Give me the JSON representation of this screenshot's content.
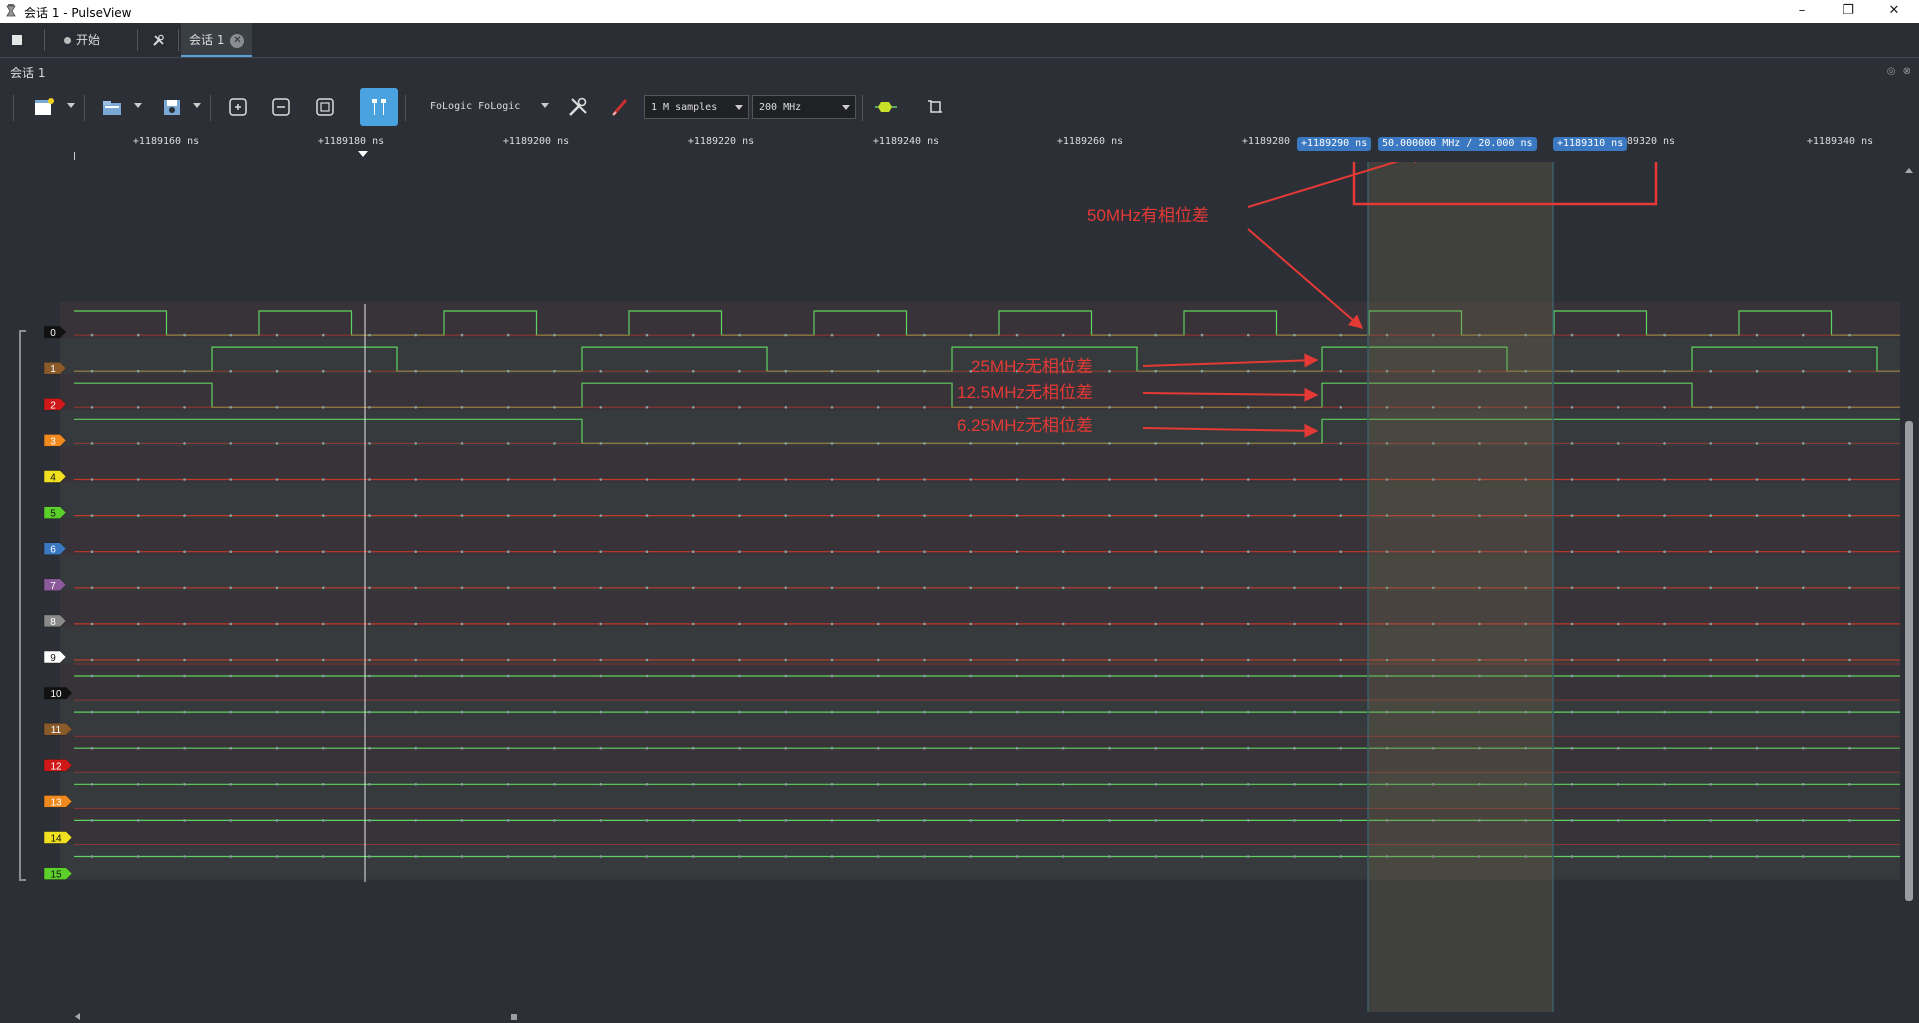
{
  "window": {
    "title": "会话 1 - PulseView",
    "minimize": "–",
    "restore": "❐",
    "close": "✕"
  },
  "tabs": {
    "stop_icon": "stop-icon",
    "start_label": "开始",
    "session_label": "会话 1"
  },
  "session_panel": {
    "label": "会话 1",
    "panel_buttons": "◎ ⊗"
  },
  "toolbar": {
    "device": "FoLogic FoLogic",
    "samples": "1 M samples",
    "rate": "200 MHz"
  },
  "ruler": {
    "labels": [
      "+1189160 ns",
      "+1189180 ns",
      "+1189200 ns",
      "+1189220 ns",
      "+1189240 ns",
      "+1189260 ns",
      "+1189280",
      "89320 ns",
      "+1189340 ns"
    ],
    "marker_left": "+1189290 ns",
    "marker_measure": "50.000000 MHz / 20.000 ns",
    "marker_right": "+1189310 ns"
  },
  "channels": [
    {
      "label": "0",
      "color": "#111111"
    },
    {
      "label": "1",
      "color": "#8b5a2b"
    },
    {
      "label": "2",
      "color": "#d01818"
    },
    {
      "label": "3",
      "color": "#f08a1e"
    },
    {
      "label": "4",
      "color": "#f0e020"
    },
    {
      "label": "5",
      "color": "#5cd02a"
    },
    {
      "label": "6",
      "color": "#3a78c2"
    },
    {
      "label": "7",
      "color": "#8a5a9a"
    },
    {
      "label": "8",
      "color": "#8a8a8a"
    },
    {
      "label": "9",
      "color": "#ffffff"
    },
    {
      "label": "10",
      "color": "#111111"
    },
    {
      "label": "11",
      "color": "#8b5a2b"
    },
    {
      "label": "12",
      "color": "#d01818"
    },
    {
      "label": "13",
      "color": "#f08a1e"
    },
    {
      "label": "14",
      "color": "#f0e020"
    },
    {
      "label": "15",
      "color": "#5cd02a"
    }
  ],
  "annotations": {
    "a50": "50MHz有相位差",
    "a25": "25MHz无相位差",
    "a12": "12.5MHz无相位差",
    "a6": "6.25MHz无相位差"
  },
  "colors": {
    "accent": "#4aa3df",
    "annotation": "#e53935",
    "signal": "#5fd35f",
    "marker_label": "#3a78c2"
  }
}
